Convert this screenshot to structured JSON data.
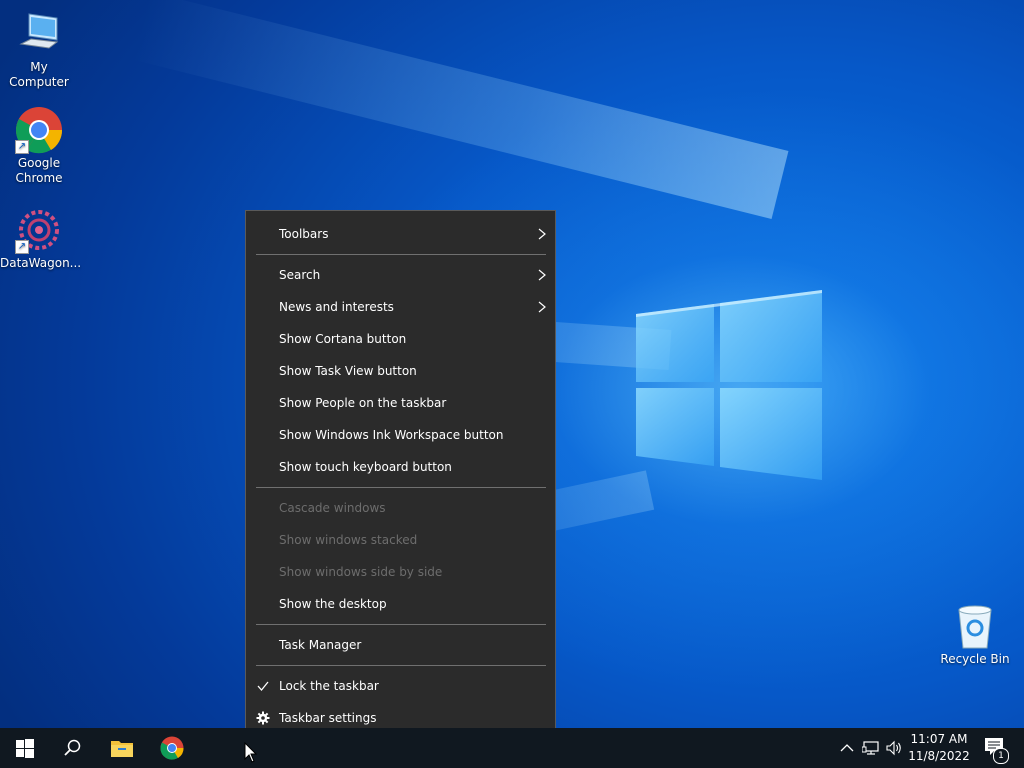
{
  "desktop": {
    "icons": [
      {
        "label": "My Computer"
      },
      {
        "label": "Google Chrome"
      },
      {
        "label": "DataWagon..."
      },
      {
        "label": "Recycle Bin"
      }
    ]
  },
  "context_menu": {
    "items": {
      "toolbars": "Toolbars",
      "search": "Search",
      "news": "News and interests",
      "cortana": "Show Cortana button",
      "task_view": "Show Task View button",
      "people": "Show People on the taskbar",
      "ink": "Show Windows Ink Workspace button",
      "touch_keyboard": "Show touch keyboard button",
      "cascade": "Cascade windows",
      "stacked": "Show windows stacked",
      "side_by_side": "Show windows side by side",
      "show_desktop": "Show the desktop",
      "task_manager": "Task Manager",
      "lock_taskbar": "Lock the taskbar",
      "taskbar_settings": "Taskbar settings"
    },
    "lock_taskbar_checked": true
  },
  "taskbar": {
    "clock_time": "11:07 AM",
    "clock_date": "11/8/2022",
    "notification_count": "1"
  }
}
